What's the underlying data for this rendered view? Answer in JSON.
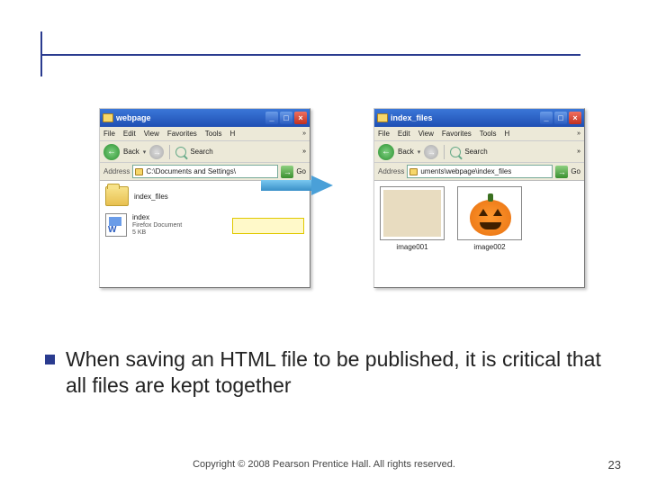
{
  "left_window": {
    "title": "webpage",
    "menu": [
      "File",
      "Edit",
      "View",
      "Favorites",
      "Tools",
      "H"
    ],
    "back_label": "Back",
    "search_label": "Search",
    "address_label": "Address",
    "address_value": "C:\\Documents and Settings\\",
    "go_label": "Go",
    "folder_item": "index_files",
    "file_name": "index",
    "file_type": "Firefox Document",
    "file_size": "5 KB"
  },
  "right_window": {
    "title": "index_files",
    "menu": [
      "File",
      "Edit",
      "View",
      "Favorites",
      "Tools",
      "H"
    ],
    "back_label": "Back",
    "search_label": "Search",
    "address_label": "Address",
    "address_value": "uments\\webpage\\index_files",
    "go_label": "Go",
    "thumb1_label": "image001",
    "thumb2_label": "image002"
  },
  "body_text": "When saving an HTML file to be published, it is critical that all files are kept together",
  "copyright": "Copyright © 2008 Pearson Prentice Hall. All rights reserved.",
  "page_number": "23"
}
